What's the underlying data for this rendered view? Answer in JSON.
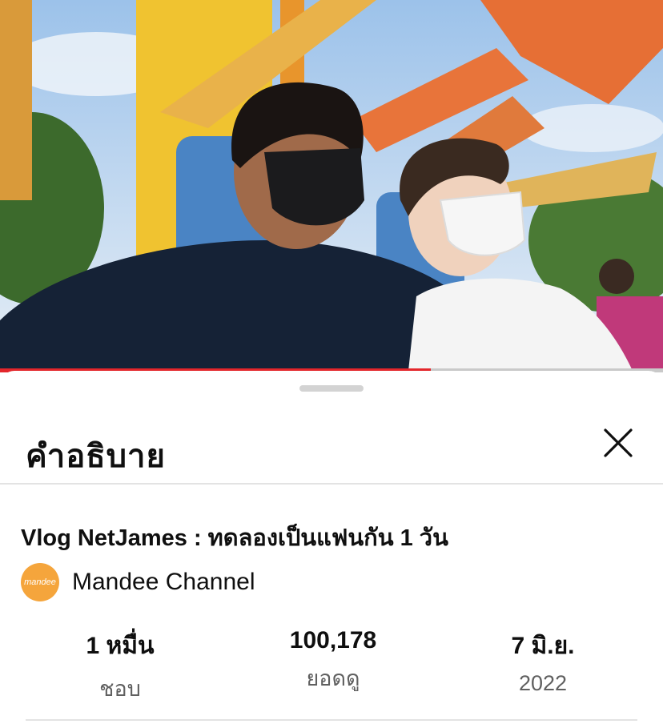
{
  "player": {
    "progress_fraction": 0.65
  },
  "description_panel": {
    "title": "คำอธิบาย",
    "close_icon": "close-icon",
    "video_title": "Vlog NetJames : ทดลองเป็นแฟนกัน 1 วัน",
    "channel": {
      "name": "Mandee Channel",
      "avatar_text": "mandee"
    },
    "stats": [
      {
        "value": "1 หมื่น",
        "label": "ชอบ"
      },
      {
        "value": "100,178",
        "label": "ยอดดู"
      },
      {
        "value": "7 มิ.ย.",
        "label": "2022"
      }
    ]
  },
  "colors": {
    "progress": "#e3262b",
    "avatar": "#f5a53c"
  }
}
